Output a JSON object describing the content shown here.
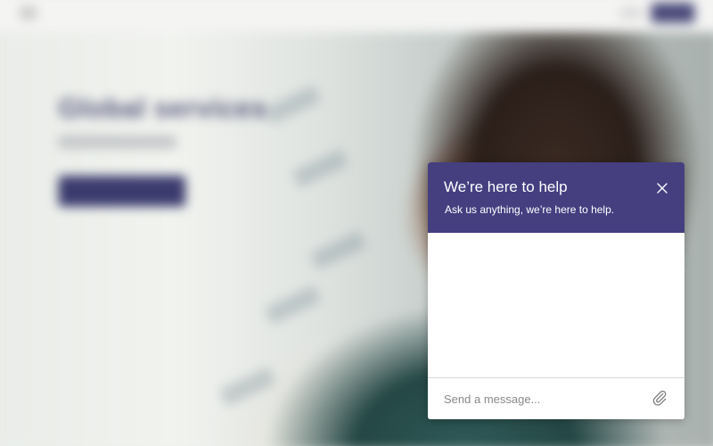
{
  "background_page": {
    "hero_heading": "Global services"
  },
  "chat_widget": {
    "title": "We’re here to help",
    "subtitle": "Ask us anything, we’re here to help.",
    "input_placeholder": "Send a message...",
    "close_icon": "close-icon",
    "attach_icon": "paperclip-icon",
    "colors": {
      "header_bg": "#453f80",
      "header_text": "#ffffff",
      "placeholder_text": "#8a8a8a"
    }
  }
}
